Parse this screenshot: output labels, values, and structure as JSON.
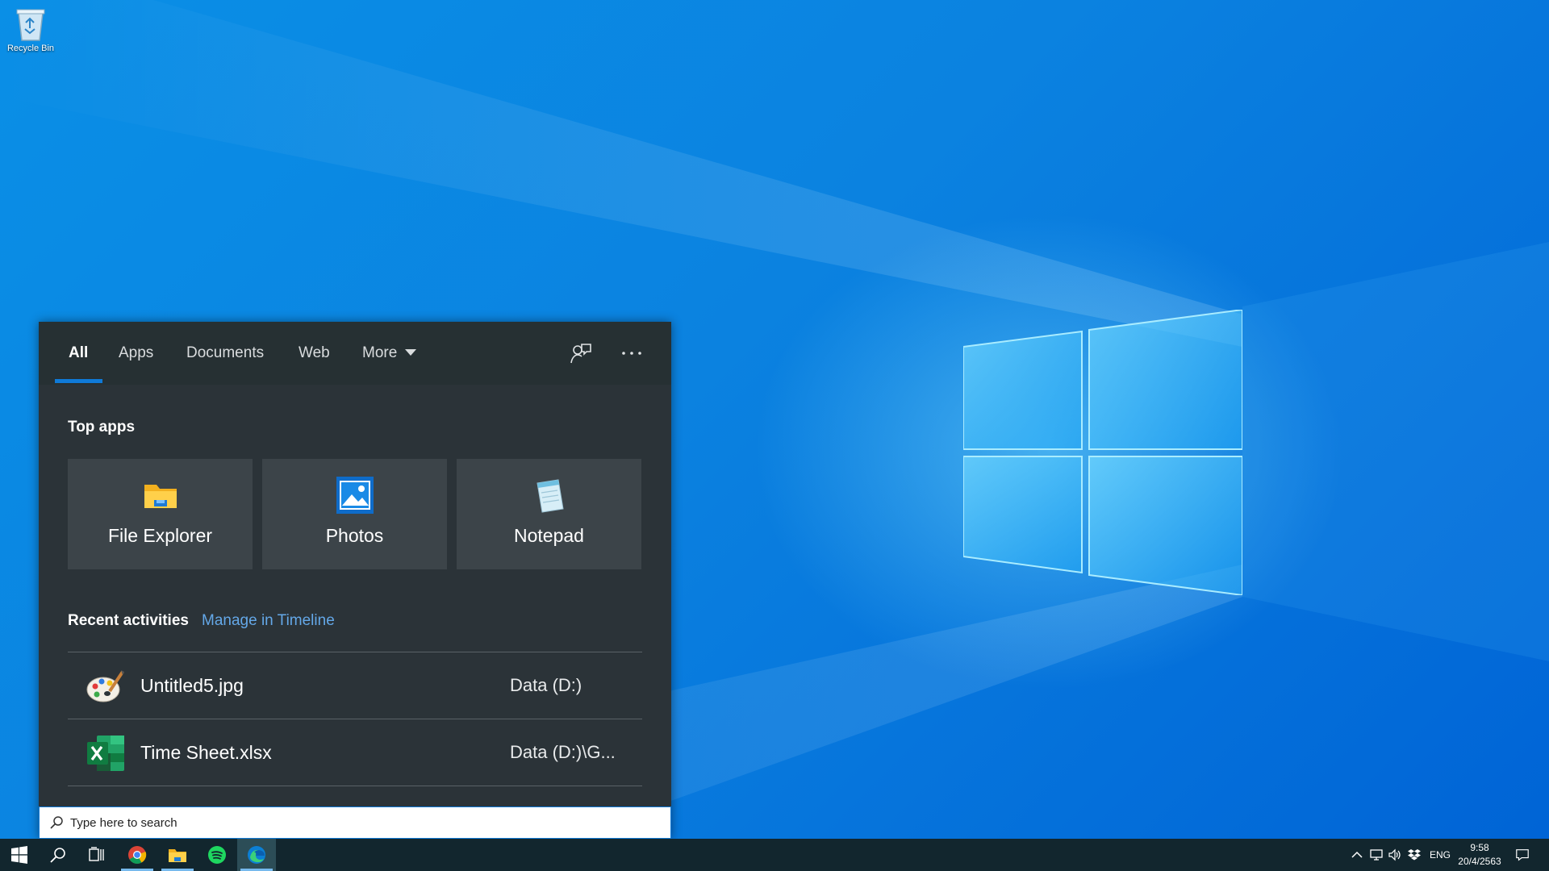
{
  "desktop": {
    "icons": [
      {
        "label": "Recycle Bin",
        "icon": "recycle-bin-icon"
      }
    ]
  },
  "search": {
    "tabs": [
      {
        "label": "All",
        "active": true
      },
      {
        "label": "Apps"
      },
      {
        "label": "Documents"
      },
      {
        "label": "Web"
      },
      {
        "label": "More",
        "has_dropdown": true
      }
    ],
    "header_icons": [
      "feedback-icon",
      "more-options-icon"
    ],
    "top_apps_title": "Top apps",
    "top_apps": [
      {
        "label": "File Explorer",
        "icon": "file-explorer-icon"
      },
      {
        "label": "Photos",
        "icon": "photos-icon"
      },
      {
        "label": "Notepad",
        "icon": "notepad-icon"
      }
    ],
    "recent_title": "Recent activities",
    "timeline_link": "Manage in Timeline",
    "recent": [
      {
        "name": "Untitled5.jpg",
        "location": "Data (D:)",
        "icon": "paint-icon"
      },
      {
        "name": "Time Sheet.xlsx",
        "location": "Data (D:)\\G...",
        "icon": "excel-icon"
      }
    ],
    "box_placeholder": "Type here to search"
  },
  "taskbar": {
    "pinned": [
      {
        "name": "start",
        "icon": "windows-start-icon"
      },
      {
        "name": "search",
        "icon": "search-icon"
      },
      {
        "name": "task-view",
        "icon": "task-view-icon"
      },
      {
        "name": "chrome",
        "icon": "chrome-icon",
        "running": true
      },
      {
        "name": "file-explorer",
        "icon": "folder-icon",
        "running": true
      },
      {
        "name": "spotify",
        "icon": "spotify-icon"
      },
      {
        "name": "edge",
        "icon": "edge-icon",
        "running": true,
        "active": true
      }
    ],
    "tray": {
      "icons": [
        "chevron-up-icon",
        "network-icon",
        "volume-icon",
        "dropbox-icon"
      ],
      "language": "ENG",
      "time": "9:58",
      "date": "20/4/2563",
      "notification_icon": "action-center-icon"
    }
  },
  "colors": {
    "accent": "#0f7ad8",
    "panel_bg": "#2b3338",
    "link": "#64a8e8",
    "taskbar_bg": "#12262e"
  }
}
